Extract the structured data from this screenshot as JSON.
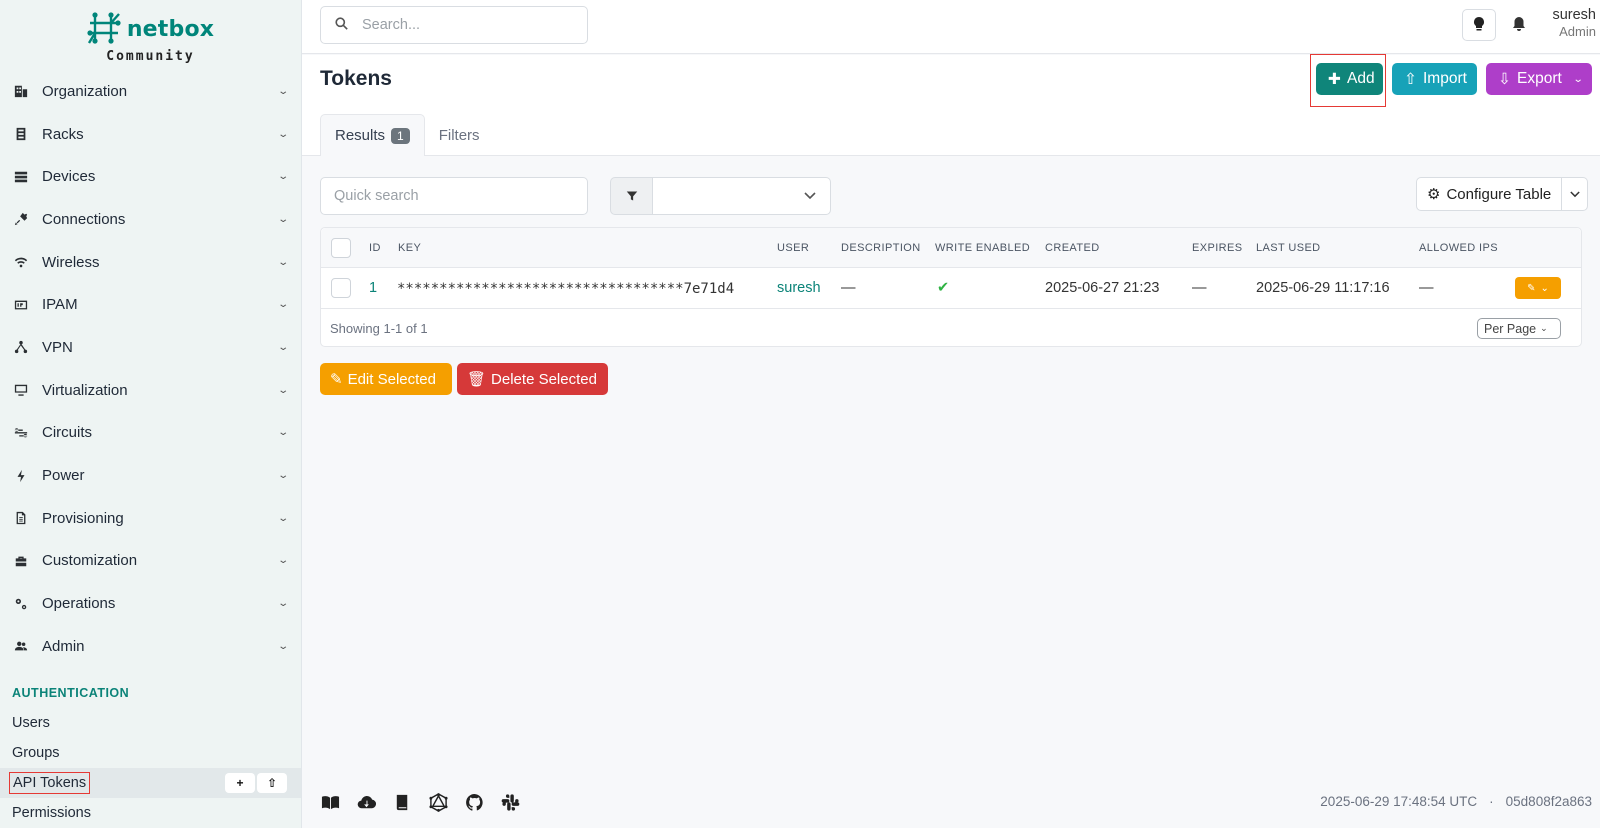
{
  "brand": {
    "name": "netbox",
    "edition": "Community"
  },
  "search": {
    "placeholder": "Search..."
  },
  "user": {
    "name": "suresh",
    "role": "Admin"
  },
  "sidebar": {
    "items": [
      {
        "label": "Organization",
        "icon": "building-icon"
      },
      {
        "label": "Racks",
        "icon": "rack-icon"
      },
      {
        "label": "Devices",
        "icon": "server-icon"
      },
      {
        "label": "Connections",
        "icon": "plug-icon"
      },
      {
        "label": "Wireless",
        "icon": "wifi-icon"
      },
      {
        "label": "IPAM",
        "icon": "ip-icon"
      },
      {
        "label": "VPN",
        "icon": "vpn-icon"
      },
      {
        "label": "Virtualization",
        "icon": "monitor-icon"
      },
      {
        "label": "Circuits",
        "icon": "circuits-icon"
      },
      {
        "label": "Power",
        "icon": "lightning-icon"
      },
      {
        "label": "Provisioning",
        "icon": "file-icon"
      },
      {
        "label": "Customization",
        "icon": "toolbox-icon"
      },
      {
        "label": "Operations",
        "icon": "cogs-icon"
      },
      {
        "label": "Admin",
        "icon": "users-icon"
      }
    ],
    "section": "AUTHENTICATION",
    "sub_items": [
      "Users",
      "Groups",
      "API Tokens",
      "Permissions"
    ],
    "mini_add": "+",
    "mini_import": "⇧"
  },
  "page": {
    "title": "Tokens",
    "add_label": "Add",
    "import_label": "Import",
    "export_label": "Export",
    "tab_results": "Results",
    "results_count": "1",
    "tab_filters": "Filters"
  },
  "toolbar": {
    "quick_search_placeholder": "Quick search",
    "configure_table": "Configure Table"
  },
  "table": {
    "columns": [
      "ID",
      "KEY",
      "USER",
      "DESCRIPTION",
      "WRITE ENABLED",
      "CREATED",
      "EXPIRES",
      "LAST USED",
      "ALLOWED IPS"
    ],
    "rows": [
      {
        "id": "1",
        "key": "**********************************7e71d4",
        "user": "suresh",
        "description": "—",
        "write_enabled": "✔",
        "created": "2025-06-27 21:23",
        "expires": "—",
        "last_used": "2025-06-29 11:17:16",
        "allowed_ips": "—"
      }
    ],
    "showing": "Showing 1-1 of 1",
    "per_page": "Per Page"
  },
  "bulk": {
    "edit_label": "Edit Selected",
    "delete_label": "Delete Selected"
  },
  "footer": {
    "timestamp": "2025-06-29 17:48:54 UTC",
    "separator": "·",
    "commit": "05d808f2a863"
  },
  "colors": {
    "brand": "#00857a",
    "add": "#0f857a",
    "import": "#17a2b8",
    "export": "#ae3ec9",
    "edit": "#f59f00",
    "delete": "#d63939"
  }
}
